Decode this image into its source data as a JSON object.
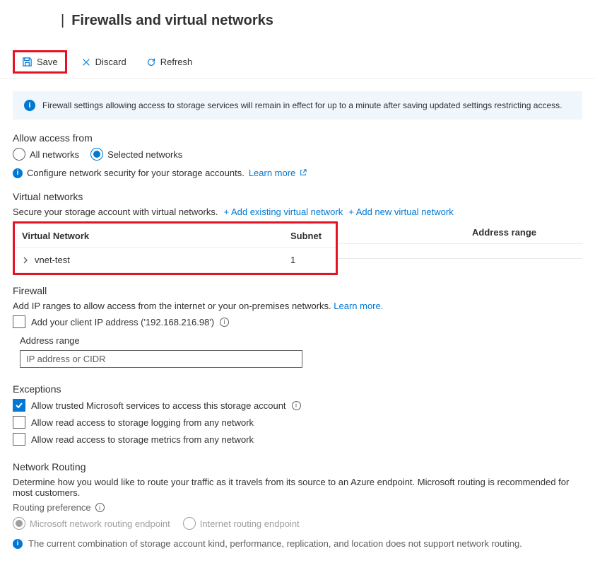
{
  "page_title": "Firewalls and virtual networks",
  "toolbar": {
    "save": "Save",
    "discard": "Discard",
    "refresh": "Refresh"
  },
  "banner": {
    "text": "Firewall settings allowing access to storage services will remain in effect for up to a minute after saving updated settings restricting access."
  },
  "access": {
    "title": "Allow access from",
    "all": "All networks",
    "selected": "Selected networks"
  },
  "configure_line": {
    "text": "Configure network security for your storage accounts.",
    "link": "Learn more"
  },
  "vnets": {
    "title": "Virtual networks",
    "subtext": "Secure your storage account with virtual networks.",
    "add_existing": "+ Add existing virtual network",
    "add_new": "+ Add new virtual network",
    "col_vnet": "Virtual Network",
    "col_subnet": "Subnet",
    "col_range": "Address range",
    "rows": [
      {
        "name": "vnet-test",
        "subnet": "1"
      }
    ]
  },
  "firewall": {
    "title": "Firewall",
    "subtext": "Add IP ranges to allow access from the internet or your on-premises networks.",
    "learn_more": "Learn more.",
    "client_ip_label": "Add your client IP address ('192.168.216.98')",
    "range_label": "Address range",
    "ip_placeholder": "IP address or CIDR"
  },
  "exceptions": {
    "title": "Exceptions",
    "opt1": "Allow trusted Microsoft services to access this storage account",
    "opt2": "Allow read access to storage logging from any network",
    "opt3": "Allow read access to storage metrics from any network"
  },
  "routing": {
    "title": "Network Routing",
    "desc": "Determine how you would like to route your traffic as it travels from its source to an Azure endpoint. Microsoft routing is recommended for most customers.",
    "pref_label": "Routing preference",
    "opt_ms": "Microsoft network routing endpoint",
    "opt_internet": "Internet routing endpoint",
    "warn": "The current combination of storage account kind, performance, replication, and location does not support network routing."
  }
}
